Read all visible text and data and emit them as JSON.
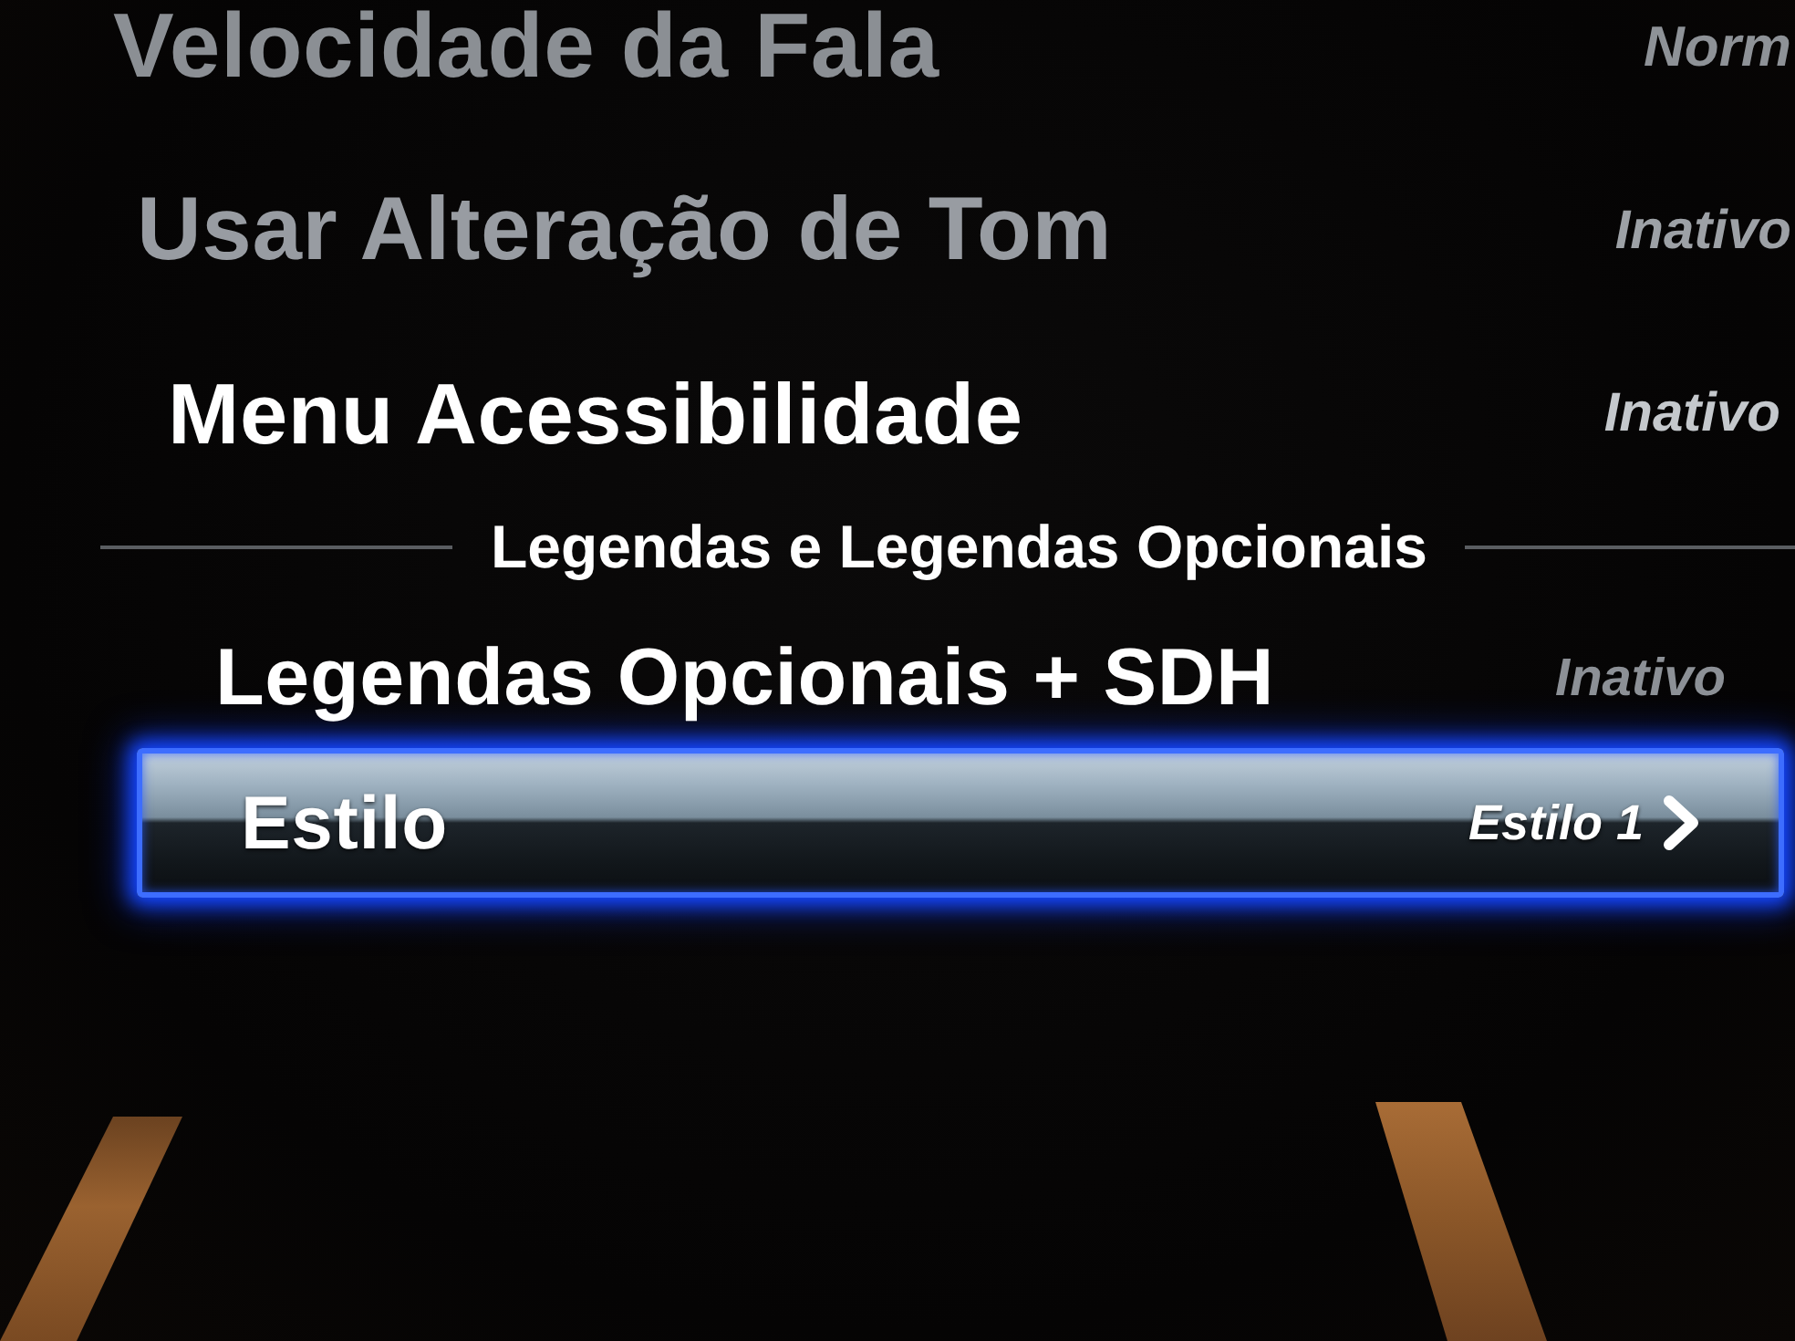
{
  "groups": [
    {
      "items": [
        {
          "label": "Velocidade da Fala",
          "value": "Norm",
          "disabled": true,
          "selected": false
        },
        {
          "label": "Usar Alteração de Tom",
          "value": "Inativo",
          "disabled": true,
          "selected": false
        },
        {
          "label": "Menu Acessibilidade",
          "value": "Inativo",
          "disabled": false,
          "selected": false
        }
      ]
    },
    {
      "header": "Legendas e Legendas Opcionais",
      "items": [
        {
          "label": "Legendas Opcionais + SDH",
          "value": "Inativo",
          "disabled": false,
          "selected": false
        },
        {
          "label": "Estilo",
          "value": "Estilo 1",
          "disabled": false,
          "selected": true
        }
      ]
    }
  ]
}
